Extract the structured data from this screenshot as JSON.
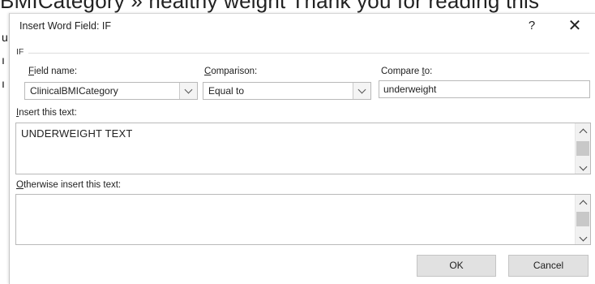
{
  "background_doc": {
    "top_line_text": "BMICategory » healthy weight Thank you for reading this",
    "edge_glyphs": [
      "u",
      "ı",
      "ı"
    ]
  },
  "dialog": {
    "title": "Insert Word Field: IF",
    "help_label": "?",
    "close_label": "✕",
    "group_label": "IF",
    "field_name": {
      "label_prefix": "",
      "label_mnemonic": "F",
      "label_rest": "ield name:",
      "value": "ClinicalBMICategory"
    },
    "comparison": {
      "label_mnemonic": "C",
      "label_rest": "omparison:",
      "value": "Equal to"
    },
    "compare_to": {
      "label_prefix": "Compare ",
      "label_mnemonic": "t",
      "label_rest": "o:",
      "value": "underweight"
    },
    "insert_text": {
      "label_mnemonic": "I",
      "label_rest": "nsert this text:",
      "value": "UNDERWEIGHT TEXT"
    },
    "otherwise_text": {
      "label_mnemonic": "O",
      "label_rest": "therwise insert this text:",
      "value": ""
    },
    "buttons": {
      "ok": "OK",
      "cancel": "Cancel"
    }
  }
}
